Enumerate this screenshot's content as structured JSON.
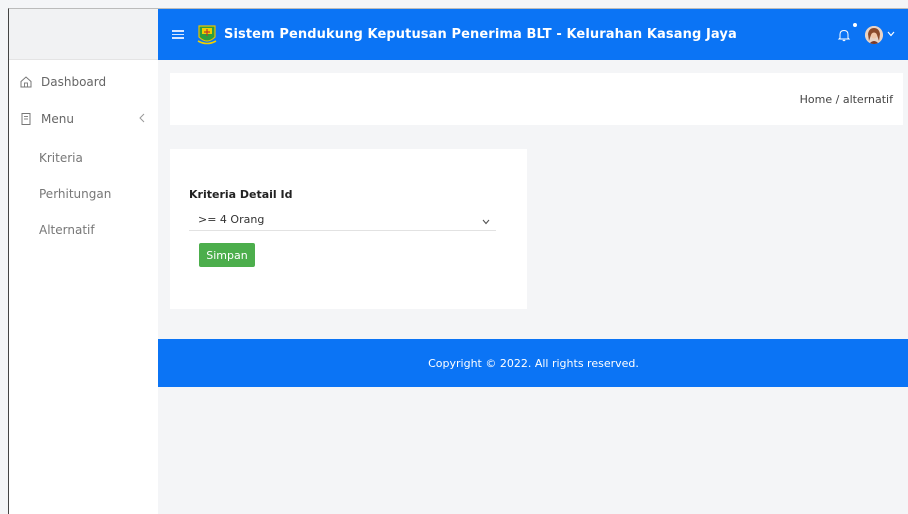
{
  "header": {
    "title": "Sistem Pendukung Keputusan Penerima BLT - Kelurahan Kasang Jaya",
    "menu_icon": "hamburger-icon",
    "logo_icon": "emblem-logo",
    "notification_icon": "bell-icon",
    "user_icon": "avatar",
    "accent": "#0b74f5"
  },
  "sidebar": {
    "dashboard_label": "Dashboard",
    "menu_label": "Menu",
    "items": [
      {
        "label": "Kriteria"
      },
      {
        "label": "Perhitungan"
      },
      {
        "label": "Alternatif"
      }
    ]
  },
  "breadcrumb": "Home / alternatif",
  "form": {
    "field_label": "Kriteria Detail Id",
    "selected_value": ">= 4 Orang",
    "submit_label": "Simpan",
    "submit_color": "#4cae4c"
  },
  "footer": {
    "text": "Copyright © 2022. All rights reserved."
  }
}
